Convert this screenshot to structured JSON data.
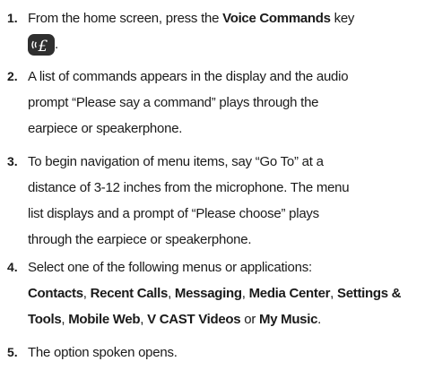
{
  "steps": [
    {
      "number": "1.",
      "lines": [
        [
          {
            "t": "From the home screen, press the "
          },
          {
            "t": "Voice Commands",
            "b": true
          },
          {
            "t": " key"
          }
        ],
        [
          {
            "icon": "voice-command-key-icon"
          },
          {
            "t": "."
          }
        ]
      ]
    },
    {
      "number": "2.",
      "lines": [
        [
          {
            "t": "A list of commands appears in the display and the audio"
          }
        ],
        [
          {
            "t": "prompt “Please say a command” plays through the"
          }
        ],
        [
          {
            "t": "earpiece or speakerphone."
          }
        ]
      ]
    },
    {
      "number": "3.",
      "lines": [
        [
          {
            "t": "To begin navigation of menu items, say “Go To” at a"
          }
        ],
        [
          {
            "t": "distance of 3-12 inches from the microphone. The menu"
          }
        ],
        [
          {
            "t": "list displays and a prompt of “Please choose” plays"
          }
        ],
        [
          {
            "t": "through the earpiece or speakerphone."
          }
        ]
      ]
    },
    {
      "number": "4.",
      "lines": [
        [
          {
            "t": "Select one of the following menus or applications:"
          }
        ],
        [
          {
            "t": "Contacts",
            "b": true
          },
          {
            "t": ", "
          },
          {
            "t": "Recent Calls",
            "b": true
          },
          {
            "t": ", "
          },
          {
            "t": "Messaging",
            "b": true
          },
          {
            "t": ", "
          },
          {
            "t": "Media Center",
            "b": true
          },
          {
            "t": ", "
          },
          {
            "t": "Settings &",
            "b": true
          }
        ],
        [
          {
            "t": "Tools",
            "b": true
          },
          {
            "t": ", "
          },
          {
            "t": "Mobile Web",
            "b": true
          },
          {
            "t": ", "
          },
          {
            "t": "V CAST Videos",
            "b": true
          },
          {
            "t": " or "
          },
          {
            "t": "My Music",
            "b": true
          },
          {
            "t": "."
          }
        ]
      ]
    },
    {
      "number": "5.",
      "lines": [
        [
          {
            "t": "The option spoken opens."
          }
        ]
      ]
    }
  ]
}
